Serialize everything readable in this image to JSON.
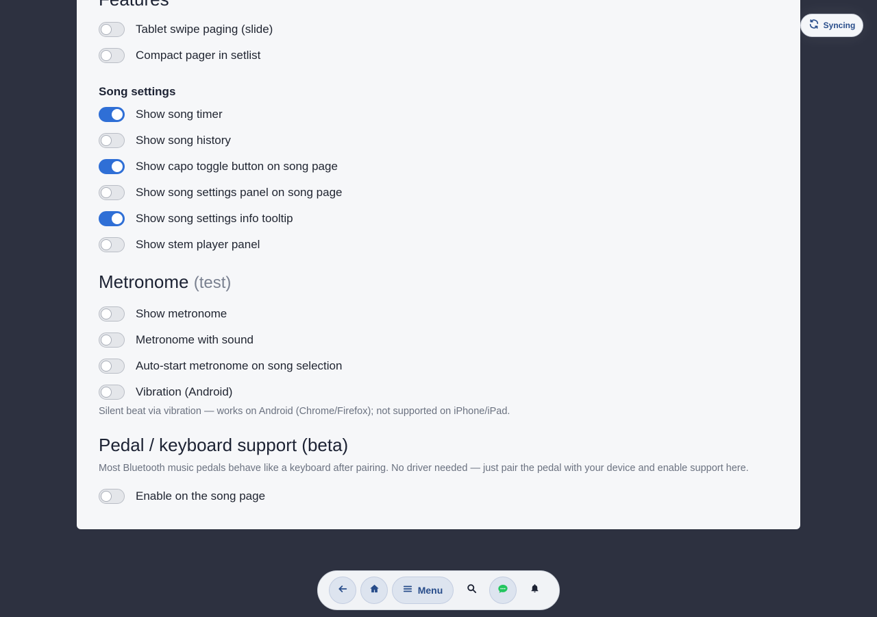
{
  "sections": {
    "features": {
      "title": "Features"
    },
    "song_settings": {
      "title": "Song settings"
    },
    "metronome": {
      "title": "Metronome",
      "suffix": "(test)",
      "note": "Silent beat via vibration — works on Android (Chrome/Firefox); not supported on iPhone/iPad."
    },
    "pedal": {
      "title": "Pedal / keyboard support (beta)",
      "note": "Most Bluetooth music pedals behave like a keyboard after pairing. No driver needed — just pair the pedal with your device and enable support here."
    }
  },
  "toggles": [
    {
      "label": "Tablet swipe paging (slide)",
      "on": false
    },
    {
      "label": "Compact pager in setlist",
      "on": false
    },
    {
      "label": "Show song timer",
      "on": true
    },
    {
      "label": "Show song history",
      "on": false
    },
    {
      "label": "Show capo toggle button on song page",
      "on": true
    },
    {
      "label": "Show song settings panel on song page",
      "on": false
    },
    {
      "label": "Show song settings info tooltip",
      "on": true
    },
    {
      "label": "Show stem player panel",
      "on": false
    },
    {
      "label": "Show metronome",
      "on": false
    },
    {
      "label": "Metronome with sound",
      "on": false
    },
    {
      "label": "Auto-start metronome on song selection",
      "on": false
    },
    {
      "label": "Vibration (Android)",
      "on": false
    },
    {
      "label": "Enable on the song page",
      "on": false
    }
  ],
  "sync": {
    "label": "Syncing",
    "icon": "sync-icon"
  },
  "nav": {
    "back_icon": "arrow-left-icon",
    "home_icon": "home-icon",
    "menu_label": "Menu",
    "menu_icon": "hamburger-icon",
    "search_icon": "search-icon",
    "chat_icon": "chat-icon",
    "bell_icon": "bell-icon"
  },
  "colors": {
    "accent": "#2f6fd6",
    "background": "#2d3140",
    "card": "#f6f7f9",
    "nav_text": "#274c8a",
    "chat_green": "#22c55e"
  }
}
